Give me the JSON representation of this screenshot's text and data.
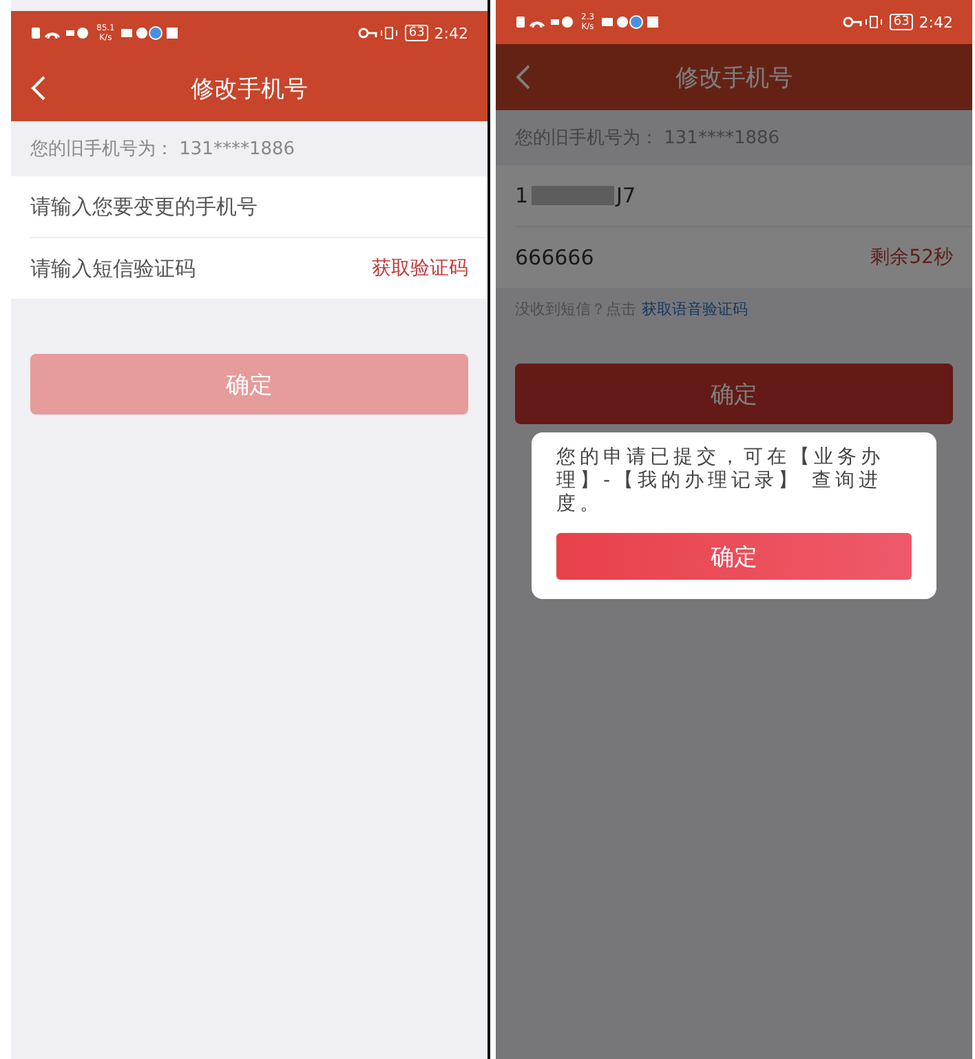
{
  "screens": [
    {
      "status_bar": {
        "speed": "85.1",
        "speed_unit": "K/s",
        "battery": "63",
        "time": "2:42"
      },
      "nav": {
        "title": "修改手机号"
      },
      "old_phone": {
        "label": "您的旧手机号为：",
        "value": "131****1886"
      },
      "phone_field": {
        "placeholder": "请输入您要变更的手机号"
      },
      "code_field": {
        "placeholder": "请输入短信验证码",
        "action": "获取验证码"
      },
      "confirm": {
        "label": "确定",
        "disabled": true
      }
    },
    {
      "status_bar": {
        "speed": "2.3",
        "speed_unit": "K/s",
        "battery": "63",
        "time": "2:42"
      },
      "nav": {
        "title": "修改手机号"
      },
      "old_phone": {
        "label": "您的旧手机号为：",
        "value": "131****1886"
      },
      "phone_field": {
        "value_start": "1",
        "value_end": "J7"
      },
      "code_field": {
        "value": "666666",
        "action": "剩余52秒"
      },
      "voice_hint": {
        "text": "没收到短信？点击",
        "link": "获取语音验证码"
      },
      "confirm": {
        "label": "确定",
        "disabled": false
      },
      "dialog": {
        "message": "您的申请已提交，可在【业务办理】-【我的办理记录】 查询进度。",
        "button": "确定"
      }
    }
  ]
}
